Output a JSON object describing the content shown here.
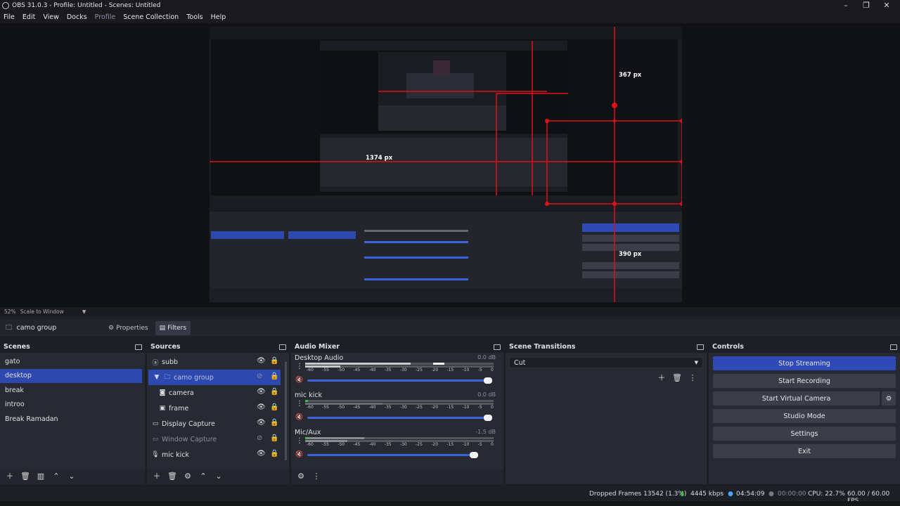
{
  "window": {
    "title": "OBS 31.0.3 - Profile: Untitled - Scenes: Untitled"
  },
  "menu": [
    "File",
    "Edit",
    "View",
    "Docks",
    "Profile",
    "Scene Collection",
    "Tools",
    "Help"
  ],
  "preview_overlay": {
    "label_top": "367 px",
    "label_left": "1374 px",
    "label_bottom": "390 px"
  },
  "scale": {
    "zoom": "52%",
    "mode": "Scale to Window"
  },
  "context": {
    "source_name": "camo group",
    "properties_label": "Properties",
    "filters_label": "Filters"
  },
  "scenes": {
    "title": "Scenes",
    "items": [
      "gato",
      "desktop",
      "break",
      "introo",
      "Break Ramadan"
    ],
    "selected_index": 1
  },
  "sources": {
    "title": "Sources",
    "items": [
      {
        "label": "subb",
        "icon": "text-icon"
      },
      {
        "label": "camo group",
        "icon": "folder-icon"
      },
      {
        "label": "camera",
        "icon": "camera-icon"
      },
      {
        "label": "frame",
        "icon": "image-icon"
      },
      {
        "label": "Display Capture",
        "icon": "monitor-icon"
      },
      {
        "label": "Window Capture",
        "icon": "window-icon"
      },
      {
        "label": "mic kick",
        "icon": "mic-icon"
      }
    ]
  },
  "audio_mixer": {
    "title": "Audio Mixer",
    "ticks": [
      "-60",
      "-55",
      "-50",
      "-45",
      "-40",
      "-35",
      "-30",
      "-25",
      "-20",
      "-15",
      "-10",
      "-5",
      "0"
    ],
    "channels": [
      {
        "name": "Desktop Audio",
        "db": "0.0 dB",
        "volume": 1.0
      },
      {
        "name": "mic kick",
        "db": "0.0 dB",
        "volume": 1.0
      },
      {
        "name": "Mic/Aux",
        "db": "-1.5 dB",
        "volume": 0.91
      }
    ]
  },
  "transitions": {
    "title": "Scene Transitions",
    "selected": "Cut"
  },
  "controls": {
    "title": "Controls",
    "stop_streaming": "Stop Streaming",
    "start_recording": "Start Recording",
    "start_virtual_camera": "Start Virtual Camera",
    "studio_mode": "Studio Mode",
    "settings": "Settings",
    "exit": "Exit"
  },
  "status": {
    "dropped_frames": "Dropped Frames 13542 (1.3%)",
    "bitrate": "4445 kbps",
    "stream_time": "04:54:09",
    "record_time": "00:00:00",
    "cpu": "CPU: 22.7%",
    "fps": "60.00 / 60.00 FPS"
  },
  "colors": {
    "accent": "#2e49ad",
    "overlay_red": "#e0101a",
    "mute_red": "#b0322c"
  }
}
